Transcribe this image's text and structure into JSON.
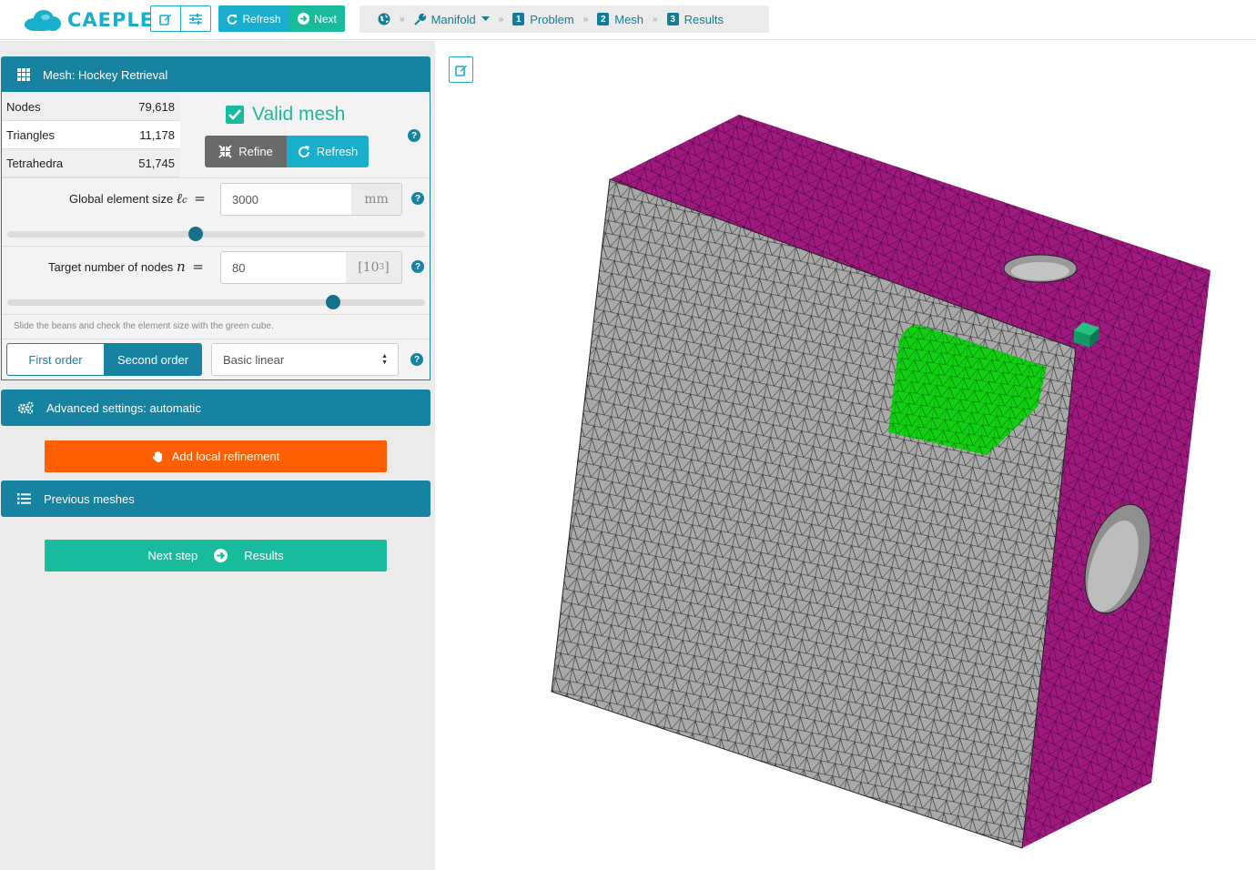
{
  "app": {
    "logo_text": "CAEPLEX"
  },
  "navbar": {
    "refresh_label": "Refresh",
    "next_label": "Next",
    "breadcrumb": {
      "project": "Manifold",
      "steps": [
        {
          "num": "1",
          "label": "Problem"
        },
        {
          "num": "2",
          "label": "Mesh"
        },
        {
          "num": "3",
          "label": "Results"
        }
      ]
    }
  },
  "mesh_panel": {
    "title": "Mesh: Hockey Retrieval",
    "stats": [
      {
        "label": "Nodes",
        "value": "79,618"
      },
      {
        "label": "Triangles",
        "value": "11,178"
      },
      {
        "label": "Tetrahedra",
        "value": "51,745"
      }
    ],
    "status": "Valid mesh",
    "refine_label": "Refine",
    "refresh_label": "Refresh",
    "global_size": {
      "label": "Global element size",
      "symbol": "ℓ",
      "sub": "c",
      "eq": "=",
      "value": "3000",
      "unit": "mm",
      "slider_fraction": 0.45
    },
    "target_nodes": {
      "label": "Target number of nodes",
      "symbol": "n",
      "eq": "=",
      "value": "80",
      "unit_base": "[10",
      "unit_exp": "3",
      "unit_close": "]",
      "slider_fraction": 0.78
    },
    "hint": "Slide the beans and check the element size with the green cube.",
    "order": {
      "first": "First order",
      "second": "Second order",
      "selected": "second"
    },
    "element_type": "Basic linear",
    "help_symbol": "?"
  },
  "advanced": {
    "title": "Advanced settings: automatic"
  },
  "local_refinement": {
    "label": "Add local refinement"
  },
  "previous_meshes": {
    "title": "Previous meshes"
  },
  "next_step": {
    "label": "Next step",
    "target": "Results"
  },
  "colors": {
    "primary": "#1683a0",
    "accent": "#1aaecd",
    "success": "#18bc9c",
    "warning": "#ff5f00",
    "mesh_gray": "#a9a9a9",
    "mesh_magenta": "#a0197f",
    "mesh_green": "#11d011"
  }
}
